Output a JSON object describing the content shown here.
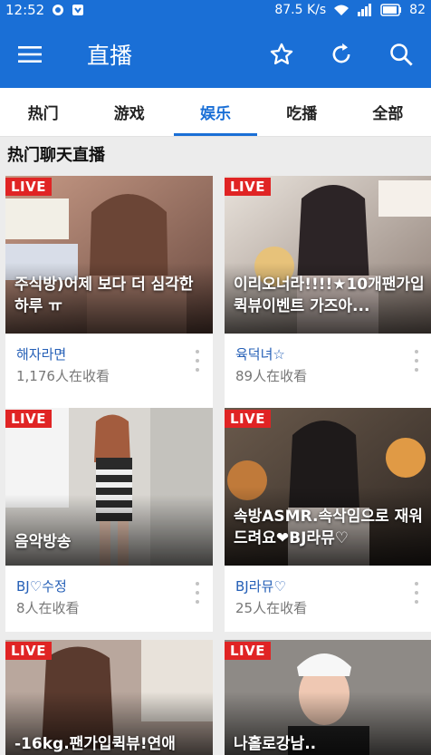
{
  "status_bar": {
    "time": "12:52",
    "speed": "87.5 K/s",
    "battery": "82"
  },
  "app_bar": {
    "title": "直播",
    "icons": [
      "menu-icon",
      "star-icon",
      "refresh-icon",
      "search-icon"
    ]
  },
  "tabs": [
    {
      "label": "热门",
      "active": false
    },
    {
      "label": "游戏",
      "active": false
    },
    {
      "label": "娱乐",
      "active": true
    },
    {
      "label": "吃播",
      "active": false
    },
    {
      "label": "全部",
      "active": false
    }
  ],
  "section_title": "热门聊天直播",
  "live_badge": "LIVE",
  "cards": [
    {
      "title": "주식방)어제 보다 더 심각한 하루 ㅠ",
      "streamer": "해자라면",
      "viewers": "1,176人在收看"
    },
    {
      "title": "이리오너라!!!!★10개팬가입 퀵뷰이벤트 가즈아...",
      "streamer": "육덕녀☆",
      "viewers": "89人在收看"
    },
    {
      "title": "음악방송",
      "streamer": "BJ♡수정",
      "viewers": "8人在收看"
    },
    {
      "title": "속방ASMR.속삭임으로 재워드려요❤BJ라뮤♡",
      "streamer": "BJ라뮤♡",
      "viewers": "25人在收看"
    },
    {
      "title": "-16kg.팬가입퀵뷰!연애",
      "streamer": "",
      "viewers": ""
    },
    {
      "title": "나홀로강남..",
      "streamer": "",
      "viewers": ""
    }
  ],
  "colors": {
    "primary": "#1a6fd6",
    "live": "#e02424",
    "streamer_text": "#2660b7"
  }
}
